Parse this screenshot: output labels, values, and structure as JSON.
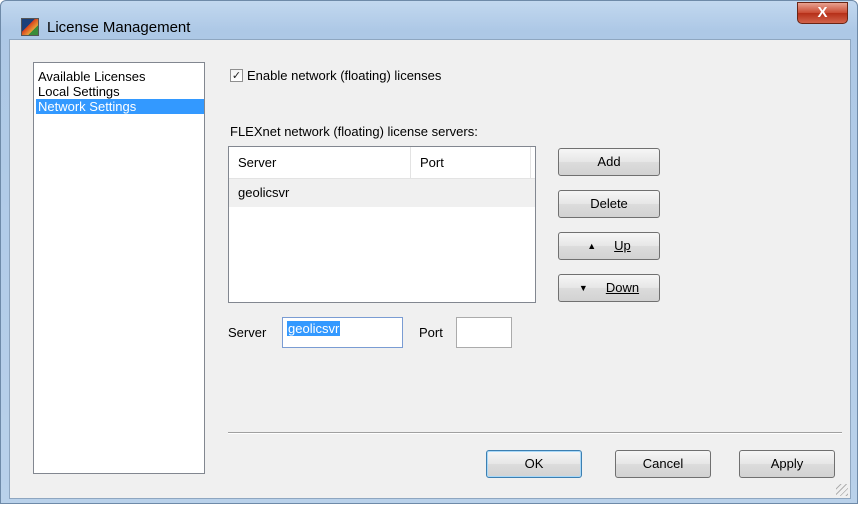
{
  "window": {
    "title": "License Management",
    "close_label": "X"
  },
  "nav": {
    "items": [
      {
        "label": "Available Licenses",
        "selected": false
      },
      {
        "label": "Local Settings",
        "selected": false
      },
      {
        "label": "Network Settings",
        "selected": true
      }
    ]
  },
  "network": {
    "enable_label": "Enable network (floating) licenses",
    "enable_checked": true,
    "check_glyph": "✓",
    "servers_label": "FLEXnet network (floating) license servers:",
    "table": {
      "columns": [
        "Server",
        "Port"
      ],
      "rows": [
        {
          "server": "geolicsvr",
          "port": ""
        }
      ]
    },
    "buttons": {
      "add": "Add",
      "delete": "Delete",
      "up": "Up",
      "down": "Down"
    },
    "server_field_label": "Server",
    "server_value": "geolicsvr",
    "port_field_label": "Port",
    "port_value": ""
  },
  "footer": {
    "ok": "OK",
    "cancel": "Cancel",
    "apply": "Apply"
  },
  "colors": {
    "selection": "#3399ff",
    "title_bar": "#b9d1ea",
    "close_button": "#c94a32"
  }
}
